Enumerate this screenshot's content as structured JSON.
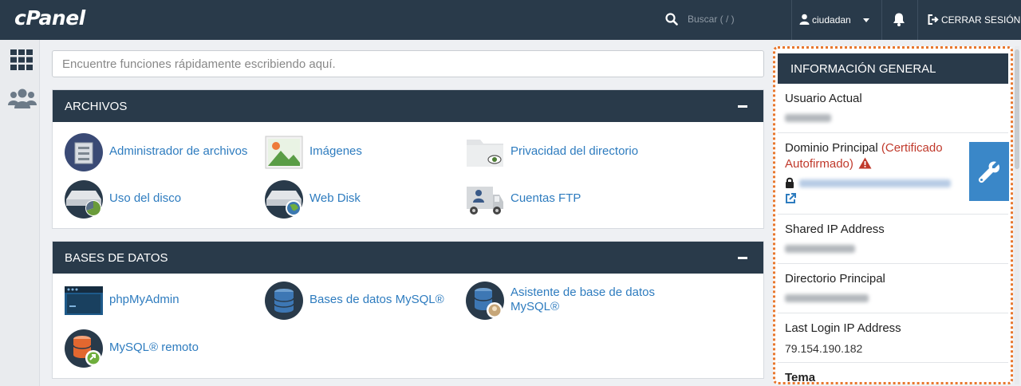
{
  "app": {
    "logo": "cPanel"
  },
  "topbar": {
    "search_placeholder": "Buscar ( / )",
    "username": "ciudadan",
    "logout_label": "CERRAR SESIÓN"
  },
  "main_search": {
    "placeholder": "Encuentre funciones rápidamente escribiendo aquí."
  },
  "sections": {
    "files": {
      "title": "ARCHIVOS",
      "items": [
        {
          "label": "Administrador de archivos",
          "icon": "file-manager-icon"
        },
        {
          "label": "Imágenes",
          "icon": "images-icon"
        },
        {
          "label": "Privacidad del directorio",
          "icon": "directory-privacy-icon"
        },
        {
          "label": "Uso del disco",
          "icon": "disk-usage-icon"
        },
        {
          "label": "Web Disk",
          "icon": "web-disk-icon"
        },
        {
          "label": "Cuentas FTP",
          "icon": "ftp-accounts-icon"
        }
      ]
    },
    "databases": {
      "title": "BASES DE DATOS",
      "items": [
        {
          "label": "phpMyAdmin",
          "icon": "phpmyadmin-icon"
        },
        {
          "label": "Bases de datos MySQL®",
          "icon": "mysql-databases-icon"
        },
        {
          "label_line1": "Asistente de base de datos",
          "label_line2": "MySQL®",
          "icon": "mysql-wizard-icon"
        },
        {
          "label": "MySQL® remoto",
          "icon": "remote-mysql-icon"
        }
      ]
    }
  },
  "general_info": {
    "title": "INFORMACIÓN GENERAL",
    "current_user_label": "Usuario Actual",
    "primary_domain_label": "Dominio Principal",
    "cert_line1": "(Certificado",
    "cert_line2": "Autofirmado)",
    "shared_ip_label": "Shared IP Address",
    "home_dir_label": "Directorio Principal",
    "last_login_label": "Last Login IP Address",
    "last_login_value": "79.154.190.182",
    "theme_label": "Tema"
  },
  "colors": {
    "topbar": "#293a4a",
    "link": "#2e7cbf",
    "highlight_border": "#e8772e",
    "warning": "#c0392b",
    "tool_button": "#3a87c8"
  }
}
